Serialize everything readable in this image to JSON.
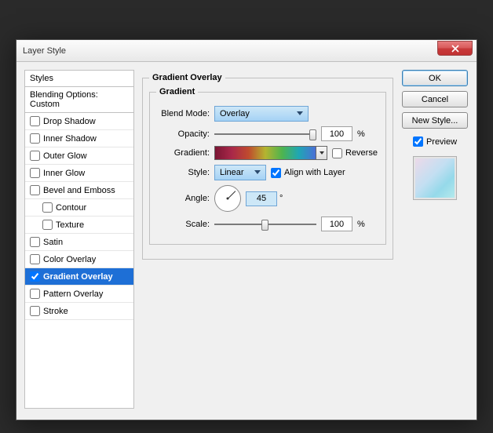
{
  "title": "Layer Style",
  "styles_header": "Styles",
  "blending_options": "Blending Options: Custom",
  "style_items": [
    {
      "label": "Drop Shadow",
      "checked": false
    },
    {
      "label": "Inner Shadow",
      "checked": false
    },
    {
      "label": "Outer Glow",
      "checked": false
    },
    {
      "label": "Inner Glow",
      "checked": false
    },
    {
      "label": "Bevel and Emboss",
      "checked": false
    },
    {
      "label": "Contour",
      "checked": false,
      "indent": true
    },
    {
      "label": "Texture",
      "checked": false,
      "indent": true
    },
    {
      "label": "Satin",
      "checked": false
    },
    {
      "label": "Color Overlay",
      "checked": false
    },
    {
      "label": "Gradient Overlay",
      "checked": true,
      "selected": true
    },
    {
      "label": "Pattern Overlay",
      "checked": false
    },
    {
      "label": "Stroke",
      "checked": false
    }
  ],
  "section": {
    "title": "Gradient Overlay",
    "subtitle": "Gradient",
    "blend_mode_label": "Blend Mode:",
    "blend_mode_value": "Overlay",
    "opacity_label": "Opacity:",
    "opacity_value": "100",
    "opacity_unit": "%",
    "gradient_label": "Gradient:",
    "reverse_label": "Reverse",
    "style_label": "Style:",
    "style_value": "Linear",
    "align_label": "Align with Layer",
    "align_checked": true,
    "angle_label": "Angle:",
    "angle_value": "45",
    "angle_unit": "°",
    "scale_label": "Scale:",
    "scale_value": "100",
    "scale_unit": "%"
  },
  "buttons": {
    "ok": "OK",
    "cancel": "Cancel",
    "new_style": "New Style..."
  },
  "preview_label": "Preview"
}
